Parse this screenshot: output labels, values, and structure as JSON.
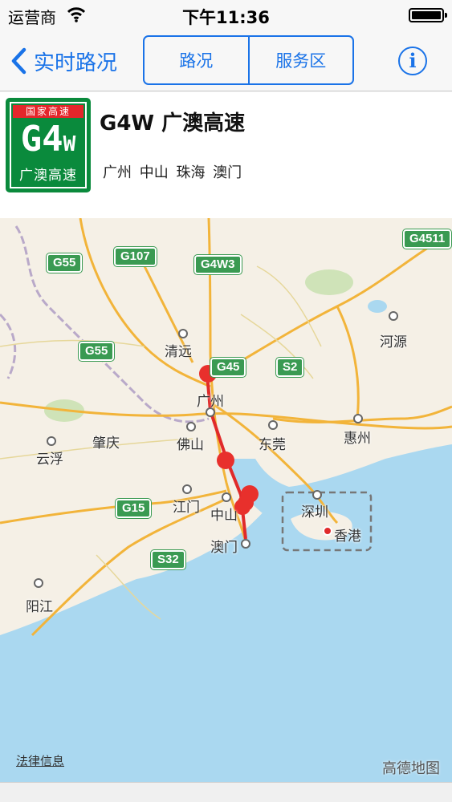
{
  "status_bar": {
    "carrier": "运营商",
    "time": "下午11:36"
  },
  "nav": {
    "back_label": "实时路况",
    "segments": [
      "路况",
      "服务区"
    ],
    "info_label": "i"
  },
  "road": {
    "shield_top": "国家高速",
    "shield_code": "G4",
    "shield_suffix": "W",
    "shield_name": "广澳高速",
    "title": "G4W 广澳高速",
    "cities": "广州 中山 珠海 澳门"
  },
  "map": {
    "cities": [
      "清远",
      "广州",
      "肇庆",
      "佛山",
      "东莞",
      "惠州",
      "河源",
      "云浮",
      "江门",
      "中山",
      "深圳",
      "香港",
      "澳门",
      "阳江"
    ],
    "badges": [
      "G4511",
      "G55",
      "G107",
      "G4W3",
      "G55",
      "G45",
      "S2",
      "G15",
      "S32"
    ],
    "legal": "法律信息",
    "logo": "高德地图"
  },
  "colors": {
    "accent": "#1a73e8",
    "route": "#e02a2a",
    "sea": "#aad8f0",
    "shield": "#0a8a3c"
  }
}
